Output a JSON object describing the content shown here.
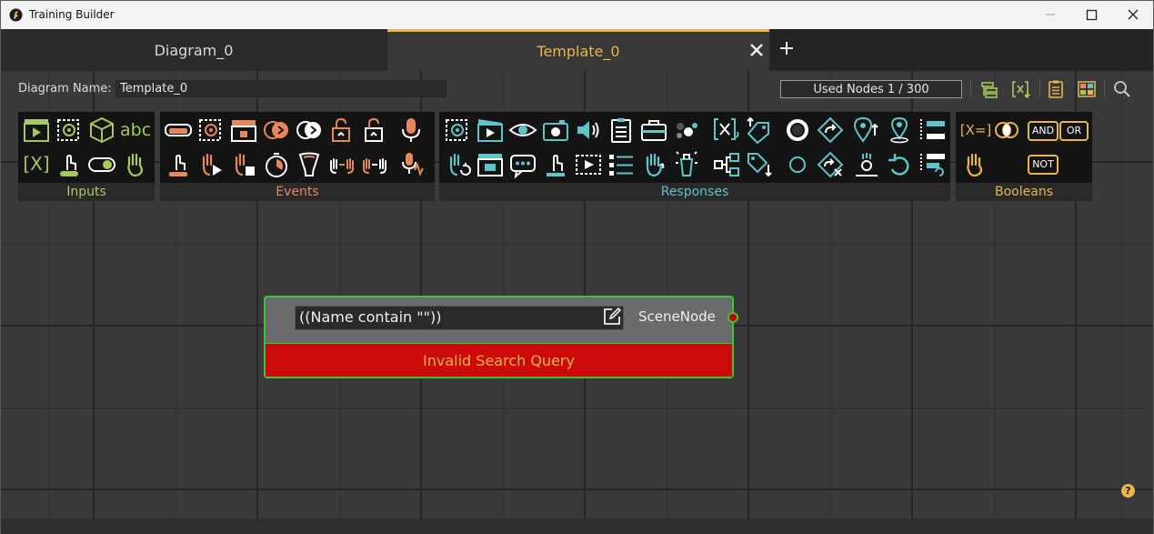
{
  "window": {
    "title": "Training Builder"
  },
  "tabs": [
    {
      "label": "Diagram_0",
      "active": false
    },
    {
      "label": "Template_0",
      "active": true
    }
  ],
  "toolbar": {
    "diagram_name_label": "Diagram Name:",
    "diagram_name_value": "Template_0",
    "used_nodes": "Used Nodes 1 / 300"
  },
  "palettes": {
    "inputs": {
      "label": "Inputs",
      "color": "#a4c95c"
    },
    "events": {
      "label": "Events",
      "color": "#e8875a"
    },
    "responses": {
      "label": "Responses",
      "color": "#5fc3c9"
    },
    "booleans": {
      "label": "Booleans",
      "color": "#e8b64c"
    }
  },
  "palette_text": {
    "abc": "abc",
    "var": "[X]",
    "xeq": "[X=]",
    "and": "AND",
    "or": "OR",
    "not": "NOT"
  },
  "node": {
    "query": "((Name contain \"\"))",
    "type": "SceneNode",
    "error": "Invalid Search Query"
  },
  "help": {
    "label": "?"
  },
  "colors": {
    "accent": "#e8b64c",
    "node_border": "#3cc33c",
    "error": "#cc0a0a"
  }
}
